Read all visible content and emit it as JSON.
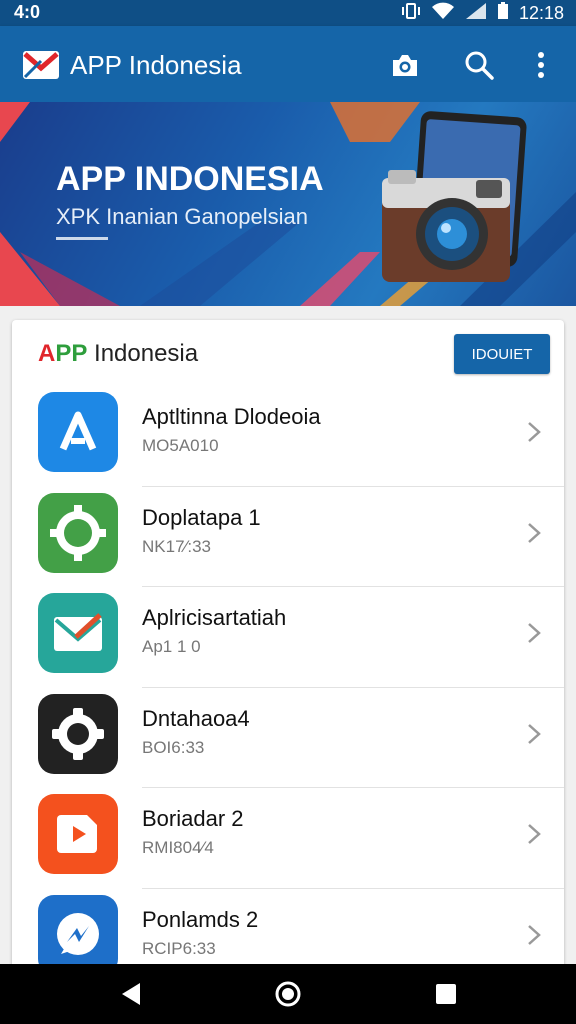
{
  "status_bar": {
    "time_left": "4:0",
    "time_right": "12:18"
  },
  "app_bar": {
    "title": "APP Indonesia"
  },
  "banner": {
    "title": "APP INDONESIA",
    "subtitle": "XPK Inanian Ganopelsian"
  },
  "card": {
    "brand_a": "A",
    "brand_pp": "PP",
    "brand_rest": " Indonesia",
    "install_label": "IDOUIET"
  },
  "apps": [
    {
      "name": "Aptltinna Dlodeoia",
      "sub": "MO5A010",
      "icon": "app-store-icon",
      "color": "#1e88e5"
    },
    {
      "name": "Doplatapa 1",
      "sub": "NK17⁄:33",
      "icon": "gear-app-icon",
      "color": "#43a047"
    },
    {
      "name": "Aplricisartatiah",
      "sub": "Ap1 1 0",
      "icon": "mail-app-icon",
      "color": "#26a69a"
    },
    {
      "name": "Dntahaoa4",
      "sub": "BOI6:33",
      "icon": "settings-app-icon",
      "color": "#222222"
    },
    {
      "name": "Boriadar 2",
      "sub": "RMI804⁄4",
      "icon": "play-app-icon",
      "color": "#f4511e"
    },
    {
      "name": "Ponlamds 2",
      "sub": "RCIP6:33",
      "icon": "messenger-app-icon",
      "color": "#1e6fc9"
    }
  ]
}
